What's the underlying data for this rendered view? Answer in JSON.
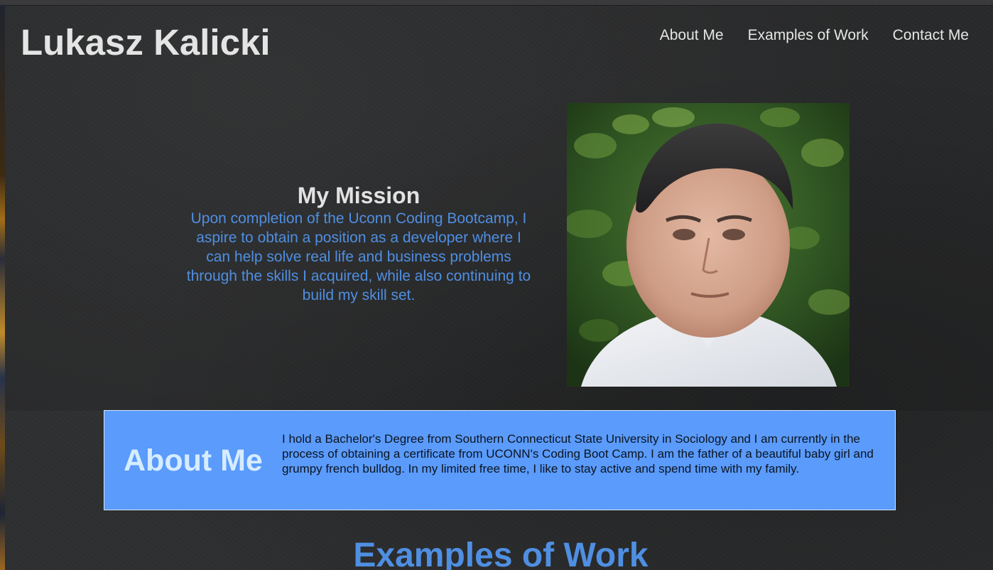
{
  "header": {
    "site_title": "Lukasz Kalicki",
    "nav": {
      "about": "About Me",
      "work": "Examples of Work",
      "contact": "Contact Me"
    }
  },
  "mission": {
    "heading": "My Mission",
    "text": "Upon completion of the Uconn Coding Bootcamp, I aspire to obtain a position as a developer where I can help solve real life and business problems through the skills I acquired, while also continuing to build my skill set."
  },
  "about": {
    "heading": "About Me",
    "text": "I hold a Bachelor's Degree from Southern Connecticut State University in Sociology and I am currently in the process of obtaining a certificate from UCONN's Coding Boot Camp. I am the father of a beautiful baby girl and grumpy french bulldog. In my limited free time, I like to stay active and spend time with my family."
  },
  "work": {
    "heading": "Examples of Work"
  },
  "colors": {
    "accent_blue": "#4f8fe2",
    "about_bg": "#5a9bfb",
    "page_bg": "#2e2f30"
  }
}
